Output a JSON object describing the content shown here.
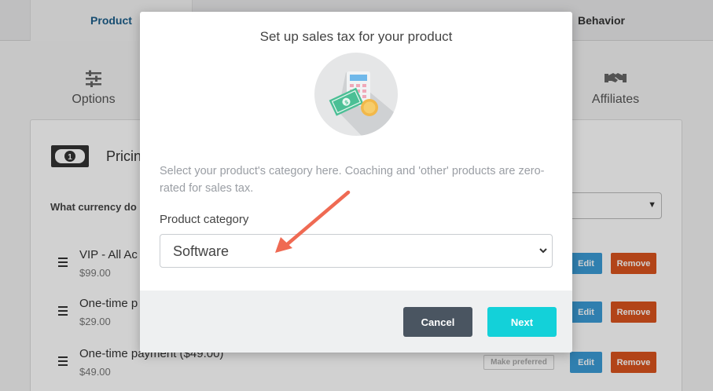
{
  "top_tabs": {
    "product": "Product",
    "behavior": "Behavior"
  },
  "sub_tabs": {
    "options": "Options",
    "affiliates": "Affiliates"
  },
  "pricing": {
    "title": "Pricin",
    "currency_label": "What currency do",
    "rows": [
      {
        "name": "VIP - All Ac",
        "price": "$99.00",
        "edit": "Edit",
        "remove": "Remove"
      },
      {
        "name": "One-time p",
        "price": "$29.00",
        "edit": "Edit",
        "remove": "Remove"
      },
      {
        "name": "One-time payment ($49.00)",
        "price": "$49.00",
        "edit": "Edit",
        "remove": "Remove",
        "preferred": "Make preferred"
      }
    ]
  },
  "modal": {
    "title": "Set up sales tax for your product",
    "description": "Select your product's category here. Coaching and 'other' products are zero-rated for sales tax.",
    "category_label": "Product category",
    "category_value": "Software",
    "cancel": "Cancel",
    "next": "Next"
  },
  "colors": {
    "next_button": "#13d1d9",
    "cancel_button": "#4a5561",
    "arrow": "#ef6a53",
    "edit_button": "#3b9bd6",
    "remove_button": "#d9541e"
  },
  "icons": [
    "sliders-icon",
    "handshake-icon",
    "money-icon",
    "drag-handle-icon",
    "calculator-cash-icon",
    "chevron-down-icon",
    "arrow-annotation"
  ]
}
